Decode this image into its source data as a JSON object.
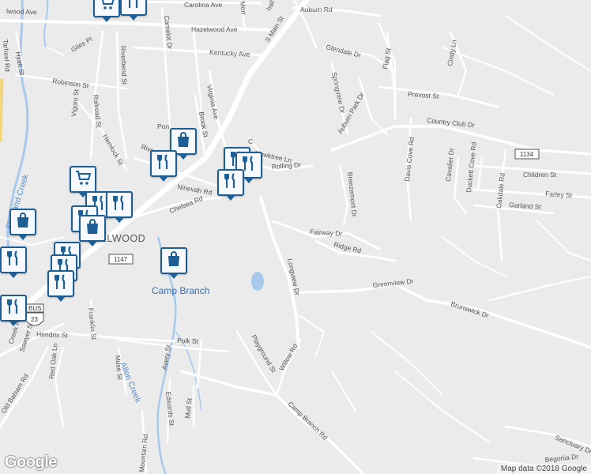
{
  "map": {
    "streets": {
      "carolina_ave": "Carolina Ave",
      "hazelwood_ave_left": "lwood Ave",
      "hazelwood_ave": "Hazelwood Ave",
      "kentucky_ave": "Kentucky Ave",
      "auburn_rd": "Auburn Rd",
      "s_main_st": "S Main St",
      "camelot_dr": "Camelot Dr",
      "riverbend_st": "Riverbend St",
      "virginia_ave": "Virginia Ave",
      "brook_st": "Brook St",
      "robinson_st": "Robinson St",
      "railroad_st": "Railroad St",
      "vigoro_st": "Vigoro St",
      "hemlock_st": "Hemlock St",
      "ninevah_rd": "Ninevah Rd",
      "chelsea_rd": "Chelsea Rd",
      "hawktree_ln": "Hawktree Ln",
      "rolling_dr": "Rolling Dr",
      "glendale_dr": "Glendale Dr",
      "springview_dr": "Springview Dr",
      "auburn_park_dr": "Auburn Park Dr",
      "flag_st": "Flag St",
      "prevost_st": "Prevost St",
      "cindy_ln": "Cindy Ln",
      "country_club_dr": "Country Club Dr",
      "davis_cove_rd": "Davis Cove Rd",
      "cavalier_dr": "Cavalier Dr",
      "duckett_cove_rd": "Duckett Cove Rd",
      "oakdale_rd": "Oakdale Rd",
      "children_st": "Children St",
      "farley_st": "Farley St",
      "garland_st": "Garland St",
      "breezemont_dr": "Breezemont Dr",
      "fairway_dr": "Fairway Dr",
      "ridge_rd": "Ridge Rd",
      "longview_dr": "Longview Dr",
      "greenview_dr": "Greenview Dr",
      "brunswick_dr": "Brunswick Dr",
      "hendrix_st": "Hendrix St",
      "franklin_st": "Franklin St",
      "polk_st": "Polk St",
      "avery_st": "Avery St",
      "playground_st": "Playground St",
      "willow_rd": "Willow Rd",
      "muse_st": "Muse St",
      "red_oak_ln": "Red Oak Ln",
      "sawyer_st": "Sawyer St",
      "old_balsam_rd": "Old Balsam Rd",
      "creek_rd": "Creek Rd",
      "mull_st": "Mull St",
      "edwards_st": "Edwards St",
      "mountain_rd": "Mountain Rd",
      "camp_branch_rd": "Camp Branch Rd",
      "sanctuary_dr": "Sanctuary Dr",
      "begonia_dr": "Begonia Dr",
      "hyatt_st": "Hyatt St",
      "tarheel_rd": "Tarheel Rd",
      "giles_pl": "Giles Pl",
      "pon_st": "Pon",
      "rivers_st": "Rivers",
      "morr_st": "Morr",
      "hall_dr": "hall Dr",
      "c_st": "C"
    },
    "water": {
      "richland_creek": "Richland Creek",
      "allen_creek": "Allen Creek"
    },
    "places": {
      "hazelwood": "HAZELWOOD",
      "camp_branch": "Camp Branch"
    },
    "route_shields": {
      "r1134": "1134",
      "r1147": "1147",
      "bus_label": "BUS",
      "us23": "23"
    },
    "pois": [
      {
        "kind": "shopping",
        "icon": "shopping-cart-icon"
      },
      {
        "kind": "restaurant",
        "icon": "fork-knife-icon"
      },
      {
        "kind": "shopping",
        "icon": "shopping-bag-icon"
      },
      {
        "kind": "restaurant",
        "icon": "fork-knife-icon"
      },
      {
        "kind": "restaurant",
        "icon": "fork-knife-icon"
      },
      {
        "kind": "restaurant",
        "icon": "fork-knife-icon"
      },
      {
        "kind": "restaurant",
        "icon": "fork-knife-icon"
      },
      {
        "kind": "shopping",
        "icon": "shopping-cart-icon"
      },
      {
        "kind": "restaurant",
        "icon": "fork-knife-icon"
      },
      {
        "kind": "restaurant",
        "icon": "fork-knife-icon"
      },
      {
        "kind": "restaurant",
        "icon": "fork-knife-icon"
      },
      {
        "kind": "shopping",
        "icon": "shopping-bag-icon"
      },
      {
        "kind": "shopping",
        "icon": "shopping-bag-icon"
      },
      {
        "kind": "restaurant",
        "icon": "fork-knife-icon"
      },
      {
        "kind": "restaurant",
        "icon": "fork-knife-icon"
      },
      {
        "kind": "restaurant",
        "icon": "fork-knife-icon"
      },
      {
        "kind": "restaurant",
        "icon": "fork-knife-icon"
      },
      {
        "kind": "shopping",
        "icon": "shopping-bag-icon"
      },
      {
        "kind": "restaurant",
        "icon": "fork-knife-icon"
      }
    ],
    "colors": {
      "land": "#ebebeb",
      "road": "#ffffff",
      "water": "#a9c9ec",
      "highway": "#f2d67a",
      "poi_border": "#1d5f95"
    }
  },
  "branding": {
    "logo": "Google",
    "attribution": "Map data ©2018 Google"
  }
}
